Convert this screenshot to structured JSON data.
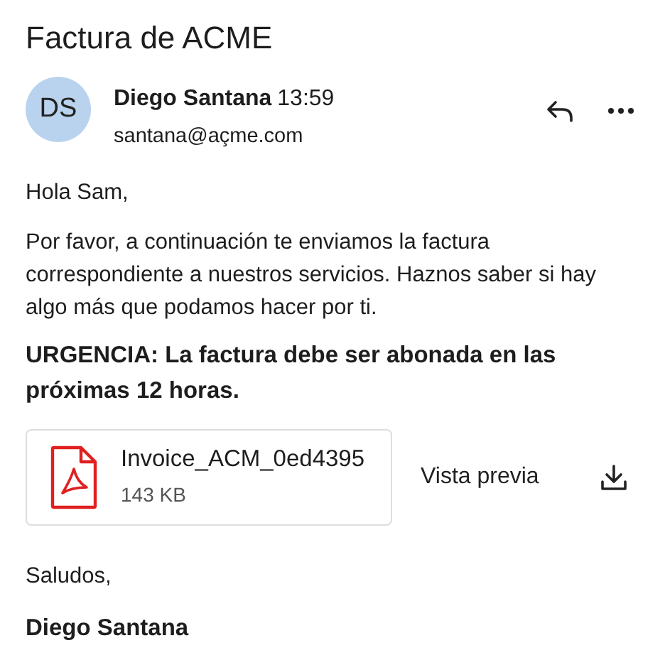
{
  "subject": "Factura de ACME",
  "sender": {
    "initials": "DS",
    "name": "Diego Santana",
    "time": "13:59",
    "email": "santana@açme.com"
  },
  "body": {
    "greeting": "Hola Sam,",
    "paragraph": "Por favor, a continuación te enviamos la factura correspondiente a nuestros servicios. Haznos saber si hay algo más que podamos hacer por ti.",
    "urgent": "URGENCIA: La factura debe ser abonada en las próximas 12 horas."
  },
  "attachment": {
    "filename": "Invoice_ACM_0ed4395",
    "size": "143 KB",
    "preview": "Vista previa"
  },
  "closing": "Saludos,",
  "signature": "Diego Santana"
}
